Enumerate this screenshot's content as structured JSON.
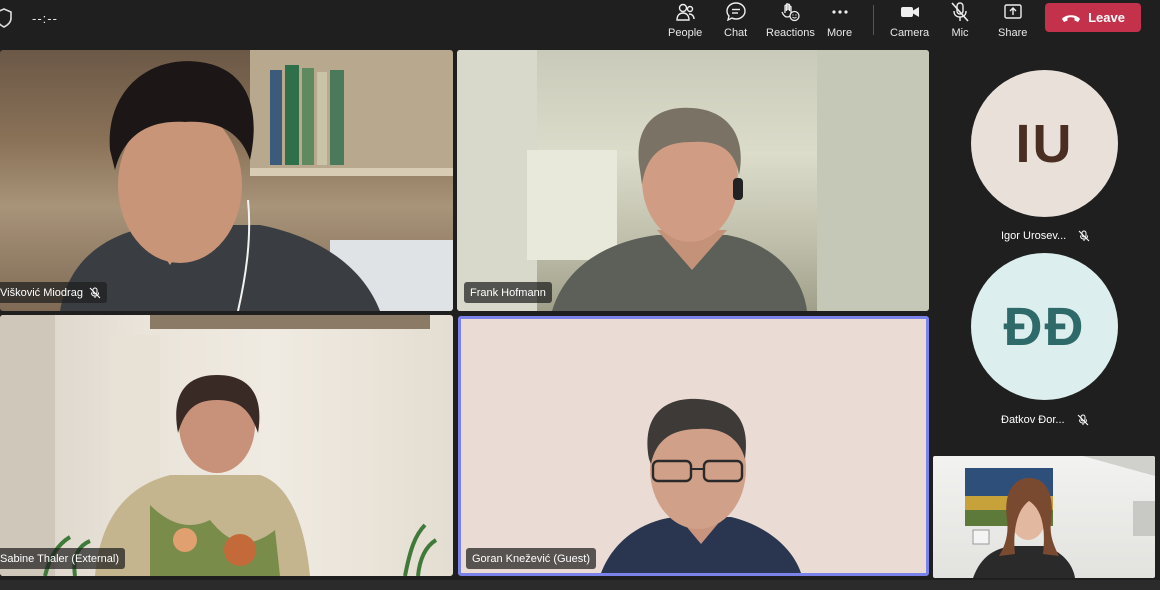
{
  "toolbar": {
    "timer": "--:--",
    "buttons": {
      "people": "People",
      "chat": "Chat",
      "reactions": "Reactions",
      "more": "More",
      "camera": "Camera",
      "mic": "Mic",
      "share": "Share"
    },
    "leave": "Leave",
    "leave_color": "#c4314b"
  },
  "tiles": [
    {
      "name": "Višković Miodrag",
      "muted": true
    },
    {
      "name": "Frank Hofmann",
      "muted": false
    },
    {
      "name": "Sabine Thaler (External)",
      "muted": false
    },
    {
      "name": "Goran Knežević (Guest)",
      "muted": false,
      "active_speaker": true
    }
  ],
  "side_participants": [
    {
      "initials": "IU",
      "name": "Igor Urosev...",
      "muted": true
    },
    {
      "initials": "ĐĐ",
      "name": "Đatkov Đor...",
      "muted": true
    }
  ],
  "highlight_color": "#7b83eb"
}
